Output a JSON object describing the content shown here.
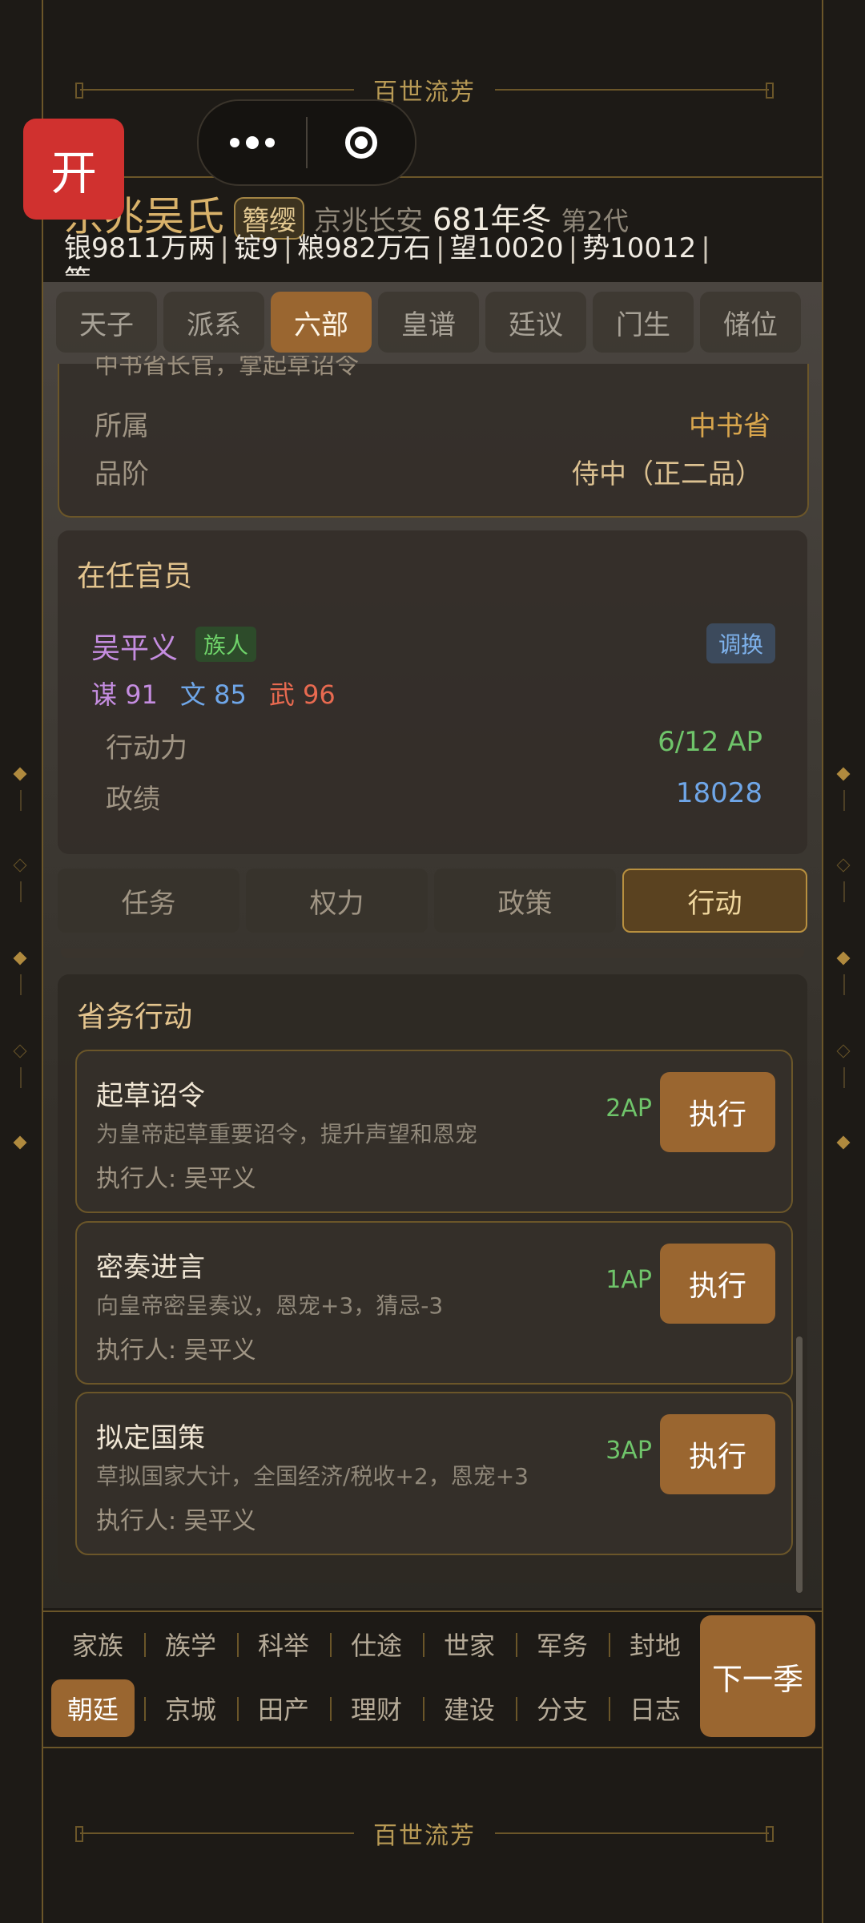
{
  "banner_text": "百世流芳",
  "open_button": "开",
  "header": {
    "clan": "京兆吴氏",
    "rank_badge": "簪缨",
    "region": "京兆长安",
    "season": "681年冬",
    "generation": "第2代",
    "resources": {
      "silver": "银9811万两",
      "ingot": "锭9",
      "grain": "粮982万石",
      "prestige": "望10020",
      "power": "势10012",
      "cut_off": "策"
    }
  },
  "tabs": [
    {
      "label": "天子",
      "active": false
    },
    {
      "label": "派系",
      "active": false
    },
    {
      "label": "六部",
      "active": true
    },
    {
      "label": "皇谱",
      "active": false
    },
    {
      "label": "廷议",
      "active": false
    },
    {
      "label": "门生",
      "active": false
    },
    {
      "label": "储位",
      "active": false
    }
  ],
  "office_info": {
    "partial_desc": "中书省长官，掌起草诏令",
    "affiliation_label": "所属",
    "affiliation_value": "中书省",
    "grade_label": "品阶",
    "grade_value": "侍中（正二品）"
  },
  "officials": {
    "title": "在任官员",
    "name": "吴平义",
    "tag": "族人",
    "swap_label": "调换",
    "stats": {
      "strategy": "谋 91",
      "literary": "文 85",
      "martial": "武 96"
    },
    "ap_label": "行动力",
    "ap_value": "6/12 AP",
    "merit_label": "政绩",
    "merit_value": "18028"
  },
  "subtabs": [
    {
      "label": "任务",
      "active": false
    },
    {
      "label": "权力",
      "active": false
    },
    {
      "label": "政策",
      "active": false
    },
    {
      "label": "行动",
      "active": true
    }
  ],
  "actions": {
    "title": "省务行动",
    "exec_label": "执行",
    "items": [
      {
        "name": "起草诏令",
        "desc": "为皇帝起草重要诏令，提升声望和恩宠",
        "executor": "执行人: 吴平义",
        "cost": "2AP"
      },
      {
        "name": "密奏进言",
        "desc": "向皇帝密呈奏议，恩宠+3，猜忌-3",
        "executor": "执行人: 吴平义",
        "cost": "1AP"
      },
      {
        "name": "拟定国策",
        "desc": "草拟国家大计，全国经济/税收+2，恩宠+3",
        "executor": "执行人: 吴平义",
        "cost": "3AP"
      }
    ]
  },
  "bottom_nav": {
    "row1": [
      "家族",
      "族学",
      "科举",
      "仕途",
      "世家",
      "军务",
      "封地"
    ],
    "row2": [
      "朝廷",
      "京城",
      "田产",
      "理财",
      "建设",
      "分支",
      "日志"
    ],
    "active": "朝廷",
    "next_season": "下一季"
  }
}
